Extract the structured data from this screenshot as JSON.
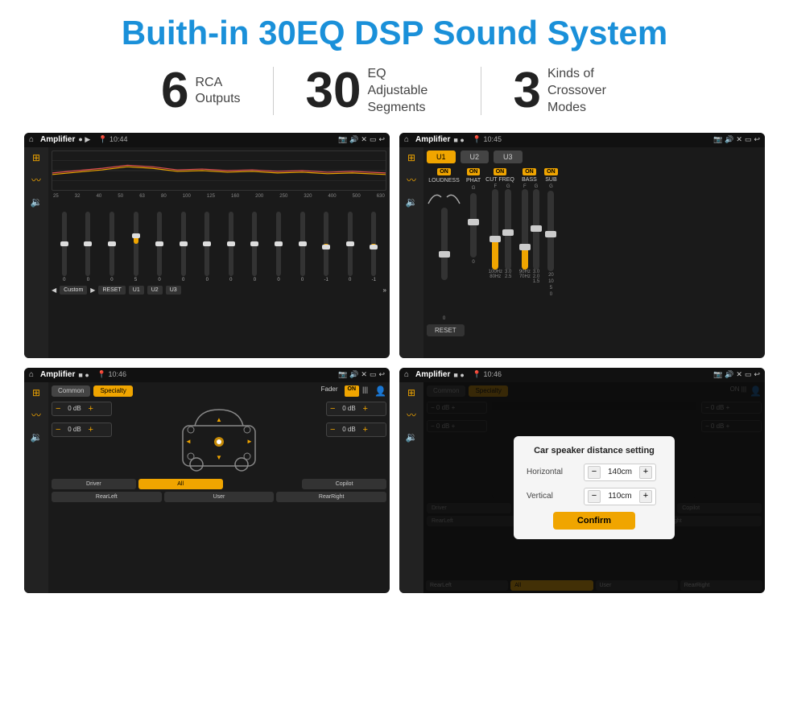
{
  "title": "Buith-in 30EQ DSP Sound System",
  "stats": [
    {
      "number": "6",
      "label": "RCA\nOutputs"
    },
    {
      "number": "30",
      "label": "EQ Adjustable\nSegments"
    },
    {
      "number": "3",
      "label": "Kinds of\nCrossover Modes"
    }
  ],
  "screens": [
    {
      "id": "eq-screen",
      "statusBar": {
        "appName": "Amplifier",
        "time": "10:44"
      },
      "eqFreqs": [
        "25",
        "32",
        "40",
        "50",
        "63",
        "80",
        "100",
        "125",
        "160",
        "200",
        "250",
        "320",
        "400",
        "500",
        "630"
      ],
      "eqValues": [
        0,
        0,
        0,
        5,
        0,
        0,
        0,
        0,
        0,
        0,
        0,
        -1,
        0,
        -1
      ],
      "controls": [
        "Custom",
        "RESET",
        "U1",
        "U2",
        "U3"
      ]
    },
    {
      "id": "crossover-screen",
      "statusBar": {
        "appName": "Amplifier",
        "time": "10:45"
      },
      "presets": [
        "U1",
        "U2",
        "U3"
      ],
      "sections": [
        "LOUDNESS",
        "PHAT",
        "CUT FREQ",
        "BASS",
        "SUB"
      ],
      "onStates": [
        true,
        true,
        true,
        true,
        true
      ]
    },
    {
      "id": "fader-screen",
      "statusBar": {
        "appName": "Amplifier",
        "time": "10:46"
      },
      "tabs": [
        "Common",
        "Specialty"
      ],
      "faderLabel": "Fader",
      "faderOn": true,
      "dbValues": [
        "0 dB",
        "0 dB",
        "0 dB",
        "0 dB"
      ],
      "bottomBtns": [
        "Driver",
        "All",
        "User",
        "RearLeft",
        "Copilot",
        "RearRight"
      ]
    },
    {
      "id": "fader-dialog-screen",
      "statusBar": {
        "appName": "Amplifier",
        "time": "10:46"
      },
      "tabs": [
        "Common",
        "Specialty"
      ],
      "dialog": {
        "title": "Car speaker distance setting",
        "fields": [
          {
            "label": "Horizontal",
            "value": "140cm"
          },
          {
            "label": "Vertical",
            "value": "110cm"
          }
        ],
        "confirmLabel": "Confirm"
      }
    }
  ]
}
